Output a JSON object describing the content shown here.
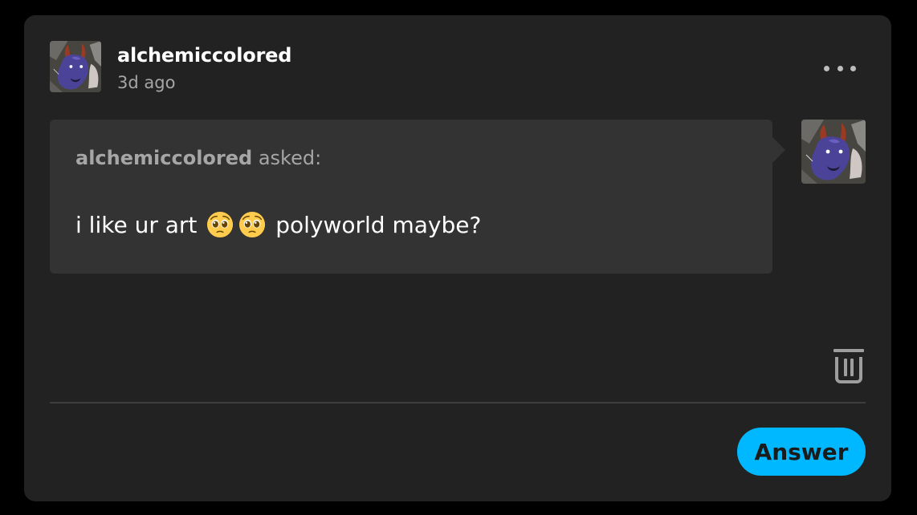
{
  "post": {
    "username": "alchemiccolored",
    "timestamp": "3d ago",
    "avatar_icon": "dragon-avatar-icon",
    "more_icon": "ellipsis-icon"
  },
  "ask": {
    "asker_name": "alchemiccolored",
    "asked_label": " asked:",
    "question_before": "i like ur art ",
    "emoji_icon": "pleading-face-emoji",
    "emoji_count": 2,
    "question_after": " polyworld maybe?"
  },
  "actions": {
    "delete_icon": "trash-icon",
    "answer_label": "Answer"
  },
  "colors": {
    "card_background": "#222222",
    "bubble_background": "#333333",
    "accent": "#00b8ff",
    "muted_text": "#a6a6a6"
  }
}
